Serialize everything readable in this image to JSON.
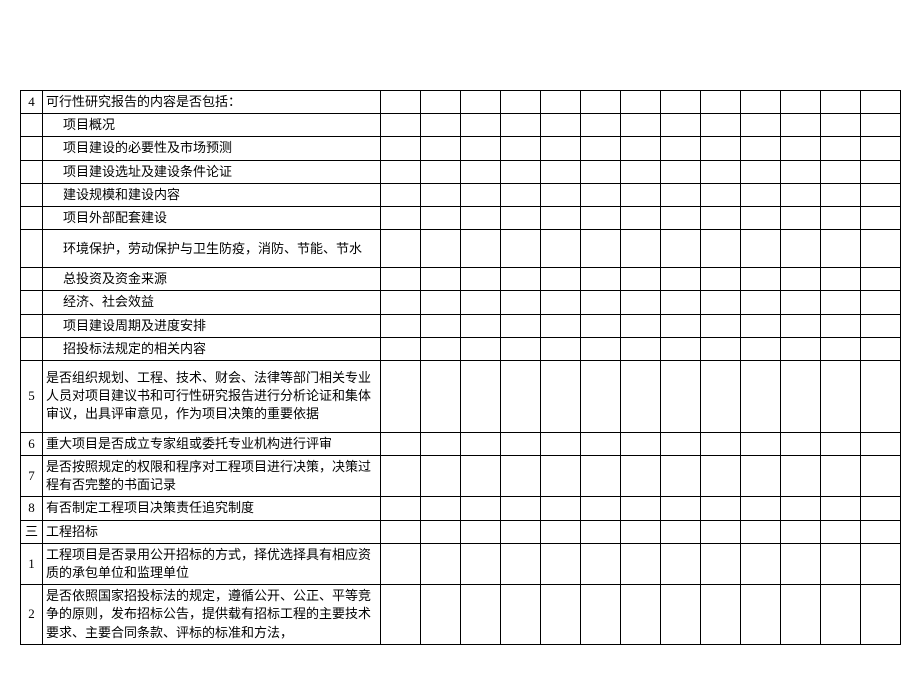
{
  "rows": [
    {
      "num": "4",
      "text": "可行性研究报告的内容是否包括：",
      "indent": false,
      "h": ""
    },
    {
      "num": "",
      "text": "项目概况",
      "indent": true,
      "h": ""
    },
    {
      "num": "",
      "text": "项目建设的必要性及市场预测",
      "indent": true,
      "h": ""
    },
    {
      "num": "",
      "text": "项目建设选址及建设条件论证",
      "indent": true,
      "h": ""
    },
    {
      "num": "",
      "text": "建设规模和建设内容",
      "indent": true,
      "h": ""
    },
    {
      "num": "",
      "text": "项目外部配套建设",
      "indent": true,
      "h": ""
    },
    {
      "num": "",
      "text": "环境保护，劳动保护与卫生防疫，消防、节能、节水",
      "indent": true,
      "h": "tall2"
    },
    {
      "num": "",
      "text": "总投资及资金来源",
      "indent": true,
      "h": ""
    },
    {
      "num": "",
      "text": "经济、社会效益",
      "indent": true,
      "h": ""
    },
    {
      "num": "",
      "text": "项目建设周期及进度安排",
      "indent": true,
      "h": ""
    },
    {
      "num": "",
      "text": "招投标法规定的相关内容",
      "indent": true,
      "h": ""
    },
    {
      "num": "5",
      "text": "是否组织规划、工程、技术、财会、法律等部门相关专业人员对项目建议书和可行性研究报告进行分析论证和集体审议，出具评审意见，作为项目决策的重要依据",
      "indent": false,
      "h": "tall4"
    },
    {
      "num": "6",
      "text": "重大项目是否成立专家组或委托专业机构进行评审",
      "indent": false,
      "h": ""
    },
    {
      "num": "7",
      "text": "是否按照规定的权限和程序对工程项目进行决策，决策过程有否完整的书面记录",
      "indent": false,
      "h": "tall2"
    },
    {
      "num": "8",
      "text": "有否制定工程项目决策责任追究制度",
      "indent": false,
      "h": ""
    },
    {
      "num": "三",
      "text": "工程招标",
      "indent": false,
      "h": ""
    },
    {
      "num": "1",
      "text": "工程项目是否录用公开招标的方式，择优选择具有相应资质的承包单位和监理单位",
      "indent": false,
      "h": "tall2"
    },
    {
      "num": "2",
      "text": "是否依照国家招投标法的规定，遵循公开、公正、平等竞争的原则，发布招标公告，提供载有招标工程的主要技术要求、主要合同条款、评标的标准和方法，",
      "indent": false,
      "h": "tall3"
    }
  ],
  "blankCols": 13
}
